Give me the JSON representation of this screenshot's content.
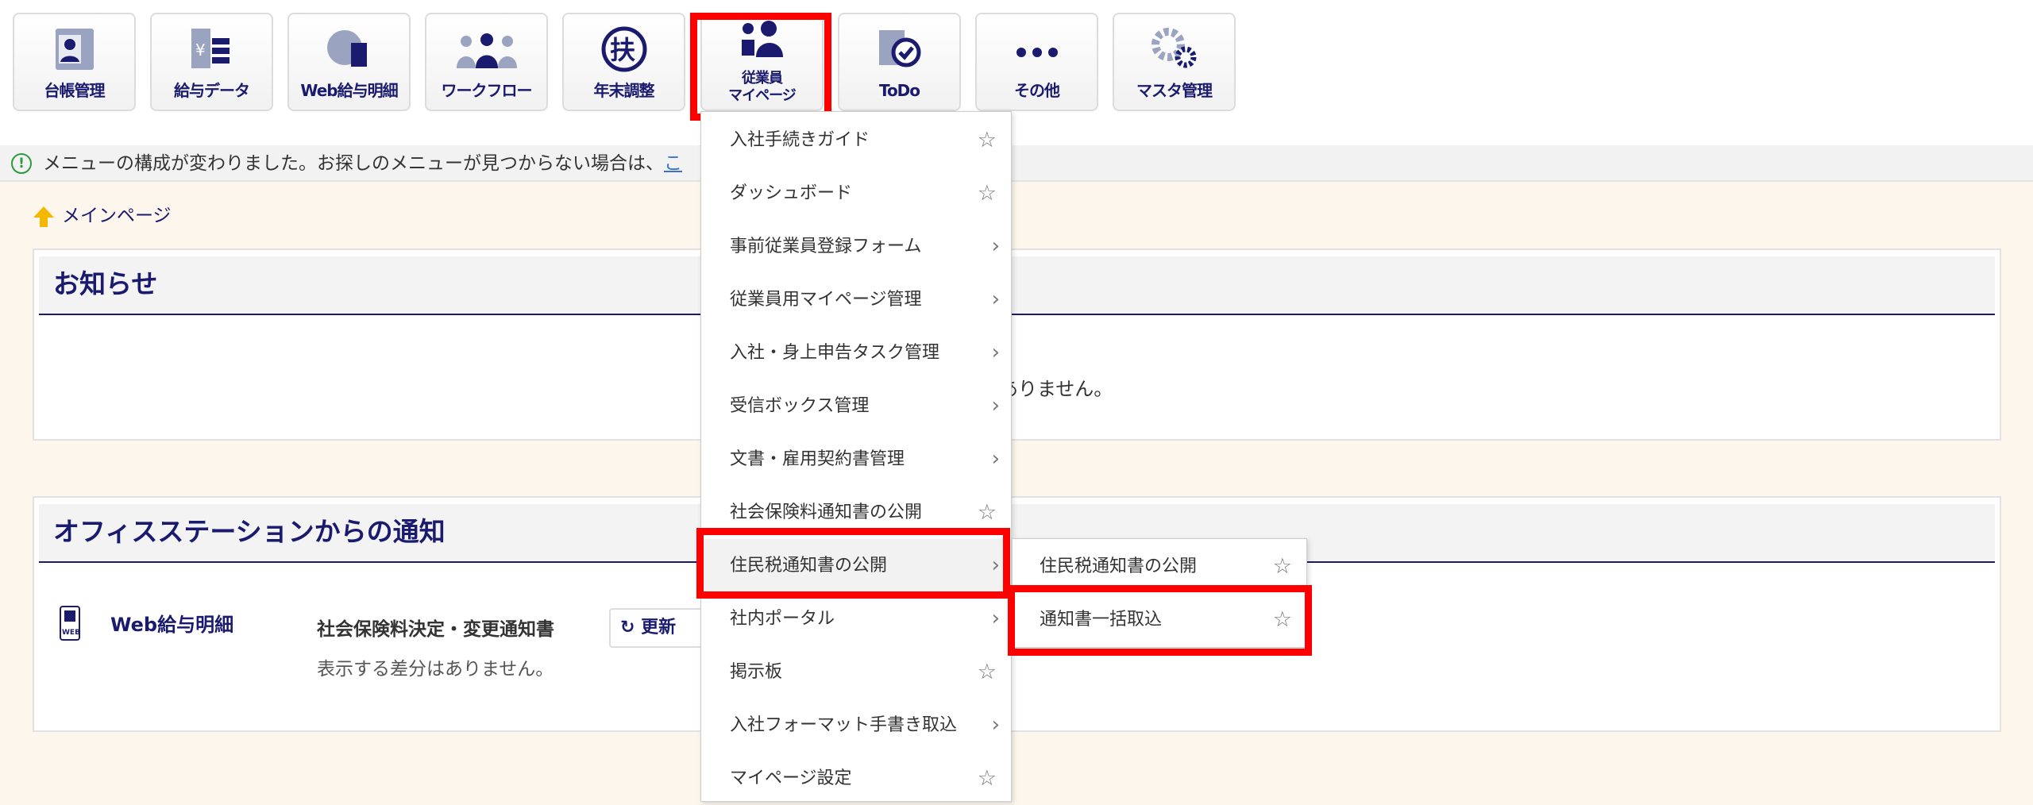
{
  "toolbar": [
    {
      "label": "台帳管理",
      "icon": "ledger-icon"
    },
    {
      "label": "給与データ",
      "icon": "payroll-data-icon"
    },
    {
      "label": "Web給与明細",
      "icon": "web-payslip-icon"
    },
    {
      "label": "ワークフロー",
      "icon": "workflow-icon"
    },
    {
      "label": "年末調整",
      "icon": "year-end-adjustment-icon"
    },
    {
      "label1": "従業員",
      "label2": "マイページ",
      "icon": "employee-mypage-icon"
    },
    {
      "label": "ToDo",
      "icon": "todo-icon"
    },
    {
      "label": "その他",
      "icon": "more-icon"
    },
    {
      "label": "マスタ管理",
      "icon": "master-settings-icon"
    }
  ],
  "notice": {
    "text": "メニューの構成が変わりました。お探しのメニューが見つからない場合は、",
    "link": "こ"
  },
  "breadcrumb": {
    "home": "メインページ"
  },
  "news": {
    "title": "お知らせ",
    "empty": "ありません。"
  },
  "office": {
    "title": "オフィスステーションからの通知",
    "service": "Web給与明細",
    "item": "社会保険料決定・変更通知書",
    "refresh": "更新",
    "empty": "表示する差分はありません。"
  },
  "menu": [
    {
      "label": "入社手続きガイド",
      "type": "star"
    },
    {
      "label": "ダッシュボード",
      "type": "star"
    },
    {
      "label": "事前従業員登録フォーム",
      "type": "chevron"
    },
    {
      "label": "従業員用マイページ管理",
      "type": "chevron"
    },
    {
      "label": "入社・身上申告タスク管理",
      "type": "chevron"
    },
    {
      "label": "受信ボックス管理",
      "type": "chevron"
    },
    {
      "label": "文書・雇用契約書管理",
      "type": "chevron"
    },
    {
      "label": "社会保険料通知書の公開",
      "type": "star"
    },
    {
      "label": "住民税通知書の公開",
      "type": "chevron"
    },
    {
      "label": "社内ポータル",
      "type": "chevron"
    },
    {
      "label": "掲示板",
      "type": "star"
    },
    {
      "label": "入社フォーマット手書き取込",
      "type": "chevron"
    },
    {
      "label": "マイページ設定",
      "type": "star"
    }
  ],
  "submenu": [
    {
      "label": "住民税通知書の公開"
    },
    {
      "label": "通知書一括取込"
    }
  ],
  "glyphs": {
    "star": "☆",
    "chevron": "›"
  },
  "colors": {
    "accent": "#1a1a6e",
    "highlight": "#ff0000"
  }
}
